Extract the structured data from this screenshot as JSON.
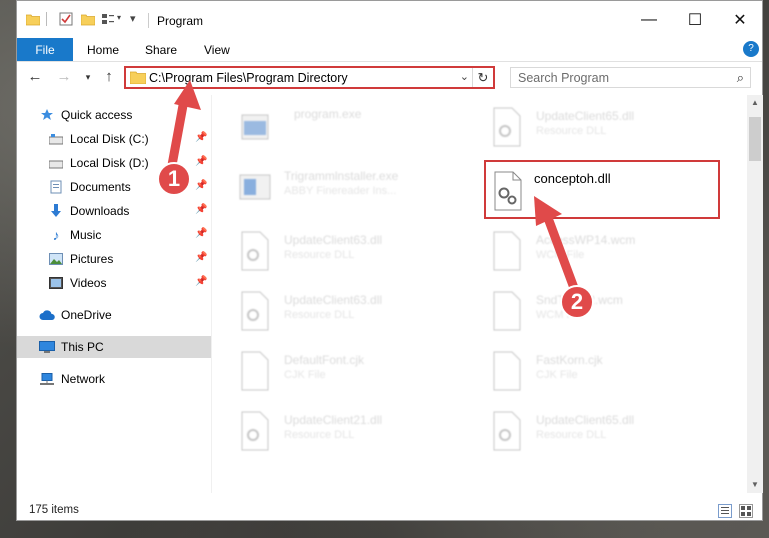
{
  "window": {
    "title": "Program",
    "controls": {
      "minimize": "—",
      "maximize": "☐",
      "close": "✕"
    }
  },
  "ribbon": {
    "file_tab": "File",
    "tabs": [
      "Home",
      "Share",
      "View"
    ]
  },
  "navigation": {
    "address": "C:\\Program Files\\Program Directory",
    "search_placeholder": "Search Program"
  },
  "sidebar": {
    "items": [
      {
        "label": "Quick access",
        "icon": "star-icon"
      },
      {
        "label": "Local Disk (C:)",
        "icon": "drive-icon",
        "pinned": true
      },
      {
        "label": "Local Disk (D:)",
        "icon": "drive-icon",
        "pinned": true
      },
      {
        "label": "Documents",
        "icon": "documents-icon",
        "pinned": true
      },
      {
        "label": "Downloads",
        "icon": "download-icon",
        "pinned": true
      },
      {
        "label": "Music",
        "icon": "music-icon",
        "pinned": true
      },
      {
        "label": "Pictures",
        "icon": "pictures-icon",
        "pinned": true
      },
      {
        "label": "Videos",
        "icon": "videos-icon",
        "pinned": true
      },
      {
        "label": "OneDrive",
        "icon": "cloud-icon"
      },
      {
        "label": "This PC",
        "icon": "computer-icon",
        "active": true
      },
      {
        "label": "Network",
        "icon": "network-icon"
      }
    ]
  },
  "files": [
    {
      "name": "program.exe",
      "type": ""
    },
    {
      "name": "UpdateClient65.dll",
      "type": "Resource DLL"
    },
    {
      "name": "Trigrammlnstaller.exe",
      "type": "ABBY Finereader Ins..."
    },
    {
      "name": "conceptoh.dll",
      "type": ""
    },
    {
      "name": "UpdateClient63.dll",
      "type": "Resource DLL"
    },
    {
      "name": "AccessWP14.wcm",
      "type": "WCM File"
    },
    {
      "name": "UpdateClient63.dll",
      "type": "Resource DLL"
    },
    {
      "name": "SndTree32.wcm",
      "type": "WCM File"
    },
    {
      "name": "DefaultFont.cjk",
      "type": "CJK File"
    },
    {
      "name": "FastKorn.cjk",
      "type": "CJK File"
    },
    {
      "name": "UpdateClient21.dll",
      "type": "Resource DLL"
    },
    {
      "name": "UpdateClient65.dll",
      "type": "Resource DLL"
    }
  ],
  "status": {
    "item_count": "175 items"
  },
  "annotations": {
    "badge_1": "1",
    "badge_2": "2"
  },
  "colors": {
    "accent": "#1979ca",
    "highlight": "#d03a3a"
  }
}
